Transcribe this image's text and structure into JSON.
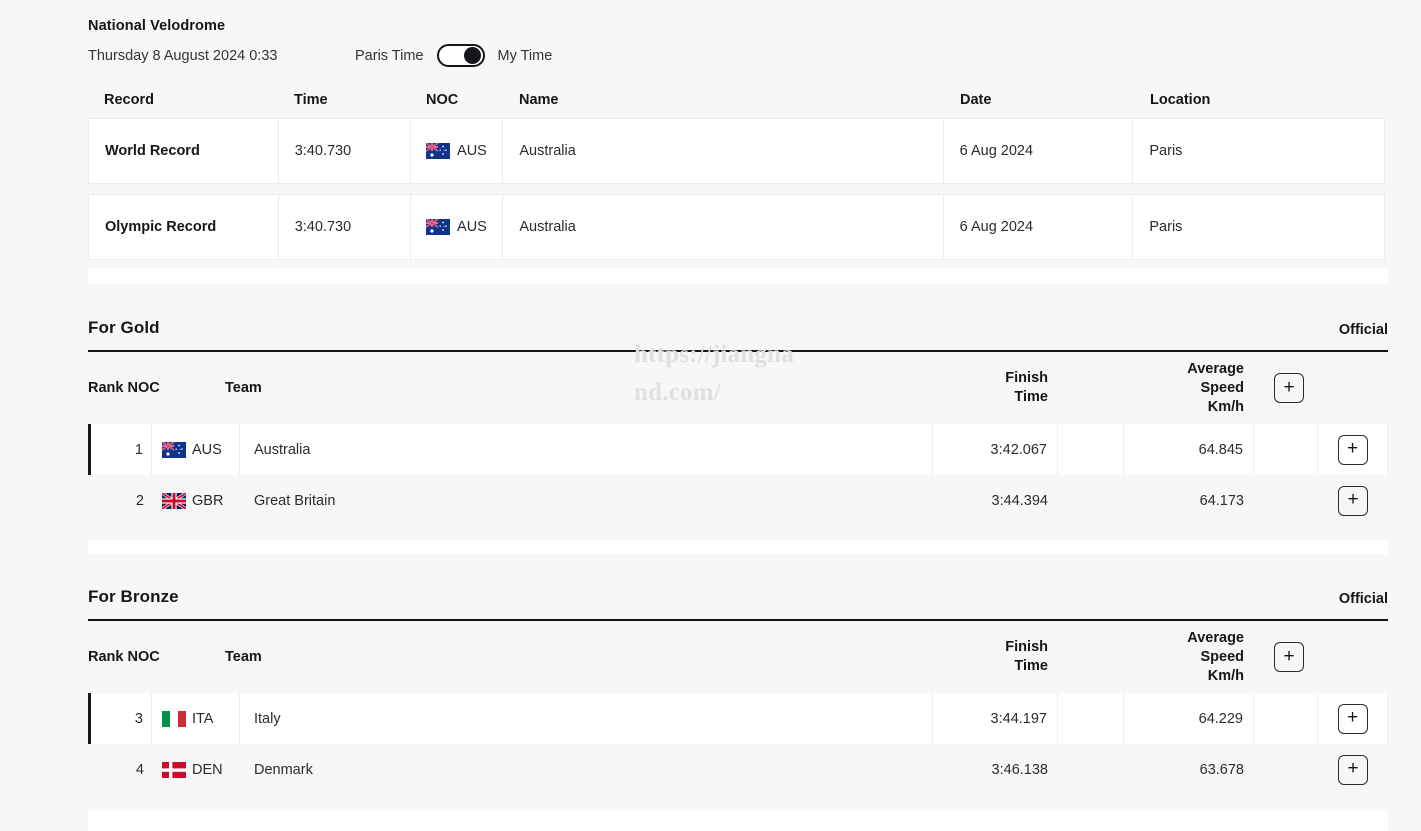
{
  "venue": {
    "name": "National Velodrome",
    "datetime": "Thursday 8 August 2024 0:33",
    "time_toggle": {
      "left_label": "Paris Time",
      "right_label": "My Time",
      "state": "my-time"
    }
  },
  "watermark": "https://jiangnand.com/",
  "records": {
    "columns": [
      "Record",
      "Time",
      "NOC",
      "Name",
      "Date",
      "Location"
    ],
    "rows": [
      {
        "record": "World Record",
        "time": "3:40.730",
        "noc": "AUS",
        "flag": "flag-australia",
        "name": "Australia",
        "date": "6 Aug 2024",
        "location": "Paris"
      },
      {
        "record": "Olympic Record",
        "time": "3:40.730",
        "noc": "AUS",
        "flag": "flag-australia",
        "name": "Australia",
        "date": "6 Aug 2024",
        "location": "Paris"
      }
    ]
  },
  "sections": [
    {
      "title": "For Gold",
      "status": "Official",
      "columns": {
        "rank_noc": "Rank NOC",
        "team": "Team",
        "finish_time_line1": "Finish",
        "finish_time_line2": "Time",
        "speed_line1": "Average",
        "speed_line2": "Speed",
        "speed_line3": "Km/h",
        "expand": "+"
      },
      "rows": [
        {
          "rank": "1",
          "noc": "AUS",
          "flag": "flag-australia",
          "team": "Australia",
          "finish_time": "3:42.067",
          "average_speed": "64.845",
          "expand": "+",
          "leader": true
        },
        {
          "rank": "2",
          "noc": "GBR",
          "flag": "flag-great-britain",
          "team": "Great Britain",
          "finish_time": "3:44.394",
          "average_speed": "64.173",
          "expand": "+",
          "leader": false
        }
      ]
    },
    {
      "title": "For Bronze",
      "status": "Official",
      "columns": {
        "rank_noc": "Rank NOC",
        "team": "Team",
        "finish_time_line1": "Finish",
        "finish_time_line2": "Time",
        "speed_line1": "Average",
        "speed_line2": "Speed",
        "speed_line3": "Km/h",
        "expand": "+"
      },
      "rows": [
        {
          "rank": "3",
          "noc": "ITA",
          "flag": "flag-italy",
          "team": "Italy",
          "finish_time": "3:44.197",
          "average_speed": "64.229",
          "expand": "+",
          "leader": true
        },
        {
          "rank": "4",
          "noc": "DEN",
          "flag": "flag-denmark",
          "team": "Denmark",
          "finish_time": "3:46.138",
          "average_speed": "63.678",
          "expand": "+",
          "leader": false
        }
      ]
    }
  ],
  "colors": {
    "page_background": "#f7f7f8",
    "row_background": "#ffffff",
    "accent_bar": "#16161a",
    "text": "#2b2b31",
    "border": "#ececee"
  }
}
